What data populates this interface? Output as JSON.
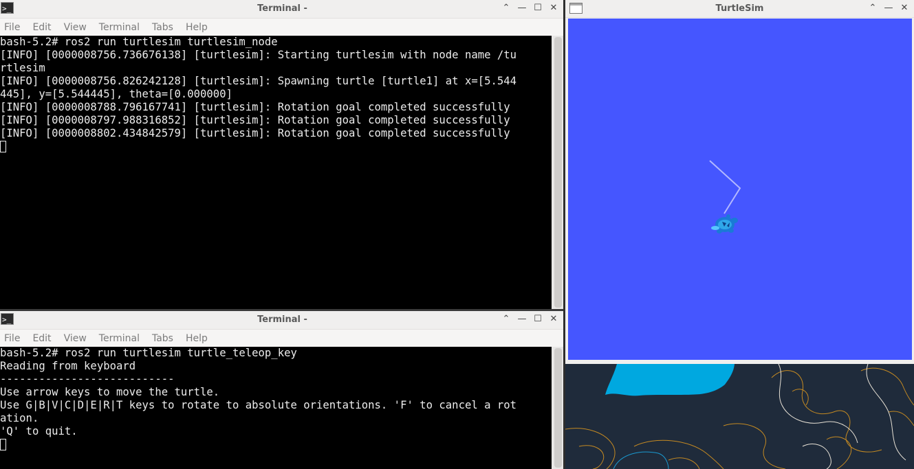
{
  "terminal_top": {
    "title": "Terminal -",
    "menu": [
      "File",
      "Edit",
      "View",
      "Terminal",
      "Tabs",
      "Help"
    ],
    "lines": [
      "bash-5.2# ros2 run turtlesim turtlesim_node",
      "[INFO] [0000008756.736676138] [turtlesim]: Starting turtlesim with node name /tu",
      "rtlesim",
      "[INFO] [0000008756.826242128] [turtlesim]: Spawning turtle [turtle1] at x=[5.544",
      "445], y=[5.544445], theta=[0.000000]",
      "[INFO] [0000008788.796167741] [turtlesim]: Rotation goal completed successfully",
      "[INFO] [0000008797.988316852] [turtlesim]: Rotation goal completed successfully",
      "[INFO] [0000008802.434842579] [turtlesim]: Rotation goal completed successfully"
    ]
  },
  "terminal_bottom": {
    "title": "Terminal -",
    "menu": [
      "File",
      "Edit",
      "View",
      "Terminal",
      "Tabs",
      "Help"
    ],
    "lines": [
      "bash-5.2# ros2 run turtlesim turtle_teleop_key",
      "Reading from keyboard",
      "---------------------------",
      "Use arrow keys to move the turtle.",
      "Use G|B|V|C|D|E|R|T keys to rotate to absolute orientations. 'F' to cancel a rot",
      "ation.",
      "'Q' to quit."
    ]
  },
  "turtlesim": {
    "title": "TurtleSim",
    "background_color": "#4556ff",
    "path_color": "#b3b8ff"
  },
  "controls": {
    "shade": "⌃",
    "minimize": "—",
    "maximize": "☐",
    "close": "✕"
  },
  "icons": {
    "terminal": ">_"
  }
}
